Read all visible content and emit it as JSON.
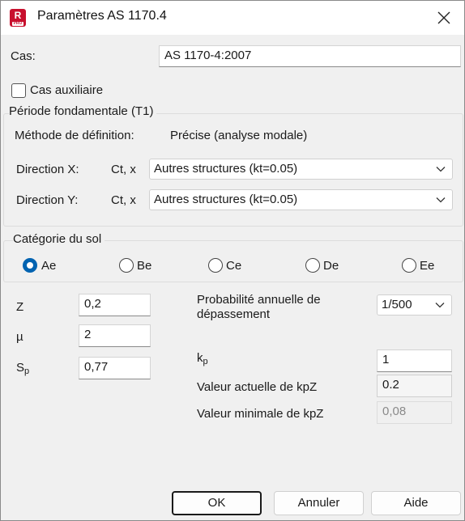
{
  "window": {
    "title": "Paramètres AS 1170.4",
    "icon_letter": "R",
    "icon_sub": "PRO"
  },
  "cas": {
    "label": "Cas:",
    "value": "AS 1170-4:2007"
  },
  "aux": {
    "label": "Cas auxiliaire",
    "checked": false
  },
  "periode": {
    "legend": "Période fondamentale (T1)",
    "method_label": "Méthode de définition:",
    "method_value": "Précise (analyse modale)",
    "dir_x_label": "Direction X:",
    "dir_x_coef": "Ct, x",
    "dir_x_value": "Autres structures (kt=0.05)",
    "dir_y_label": "Direction Y:",
    "dir_y_coef": "Ct, x",
    "dir_y_value": "Autres structures (kt=0.05)"
  },
  "sol": {
    "legend": "Catégorie du sol",
    "options": [
      "Ae",
      "Be",
      "Ce",
      "De",
      "Ee"
    ],
    "selected": "Ae"
  },
  "params": {
    "z_label": "Z",
    "z_value": "0,2",
    "mu_label": "µ",
    "mu_value": "2",
    "sp_label": "S",
    "sp_sub": "p",
    "sp_value": "0,77"
  },
  "proba": {
    "label_line1": "Probabilité annuelle de",
    "label_line2": "dépassement",
    "value": "1/500"
  },
  "kp": {
    "label": "k",
    "sub": "p",
    "value": "1"
  },
  "kpz_actual": {
    "label": "Valeur actuelle de kpZ",
    "value": "0.2"
  },
  "kpz_min": {
    "label": "Valeur minimale de kpZ",
    "value": "0,08"
  },
  "buttons": {
    "ok": "OK",
    "cancel": "Annuler",
    "help": "Aide"
  },
  "colors": {
    "accent": "#0063b1",
    "brand": "#c8102e"
  }
}
